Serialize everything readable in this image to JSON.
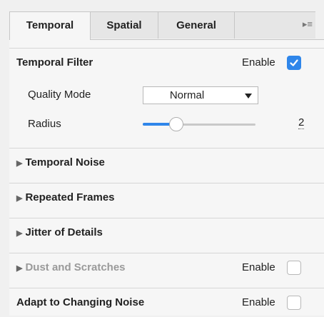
{
  "tabs": [
    {
      "label": "Temporal",
      "active": true
    },
    {
      "label": "Spatial",
      "active": false
    },
    {
      "label": "General",
      "active": false
    }
  ],
  "tab_menu_icon": "▸≡",
  "temporal_filter": {
    "title": "Temporal Filter",
    "enable_label": "Enable",
    "enabled": true,
    "quality_mode": {
      "label": "Quality Mode",
      "value": "Normal"
    },
    "radius": {
      "label": "Radius",
      "value": "2",
      "slider_fraction": 0.3
    }
  },
  "sections": [
    {
      "title": "Temporal Noise",
      "collapsed": true
    },
    {
      "title": "Repeated Frames",
      "collapsed": true
    },
    {
      "title": "Jitter of Details",
      "collapsed": true
    },
    {
      "title": "Dust and Scratches",
      "collapsed": true,
      "disabled": true,
      "enable_label": "Enable",
      "enabled": false
    },
    {
      "title": "Adapt to Changing Noise",
      "enable_label": "Enable",
      "enabled": false
    }
  ],
  "colors": {
    "accent": "#2f86ea",
    "muted_text": "#9a9a9a"
  }
}
